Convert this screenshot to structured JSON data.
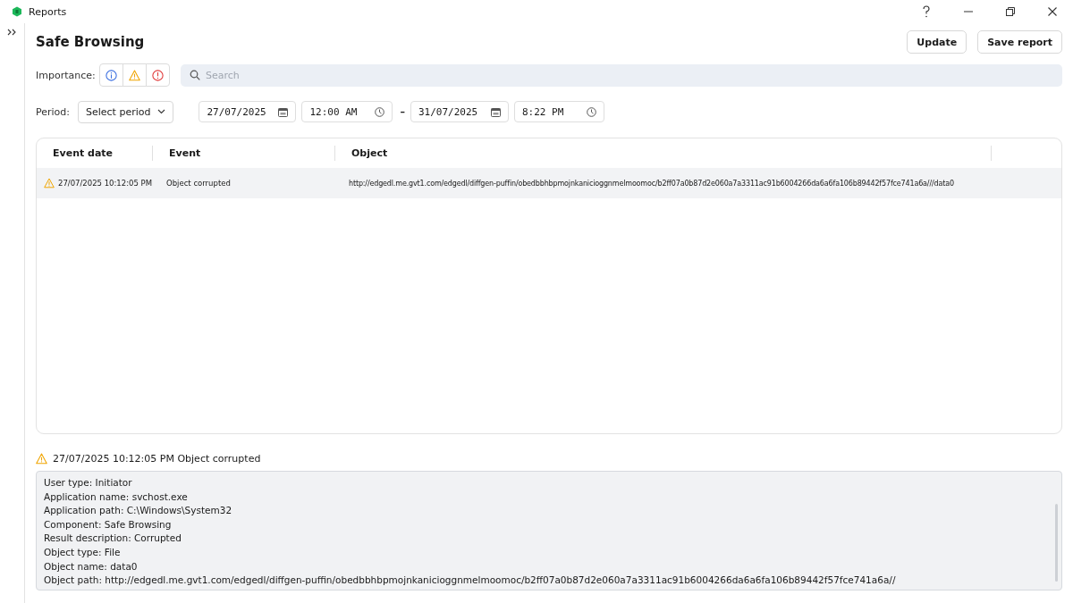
{
  "window": {
    "title": "Reports"
  },
  "page": {
    "title": "Safe Browsing",
    "buttons": [
      "Update",
      "Save report"
    ]
  },
  "importance": {
    "label": "Importance:",
    "levels": [
      {
        "kind": "info"
      },
      {
        "kind": "warning"
      },
      {
        "kind": "error"
      }
    ]
  },
  "search": {
    "placeholder": "Search"
  },
  "period": {
    "label": "Period:",
    "select": "Select period",
    "from_date": "27/07/2025",
    "from_time": "12:00 AM",
    "separator": "–",
    "to_date": "31/07/2025",
    "to_time": "8:22 PM"
  },
  "table": {
    "columns": [
      "Event date",
      "Event",
      "Object"
    ],
    "rows": [
      {
        "kind": "warning",
        "selected": true,
        "cells": [
          "27/07/2025 10:12:05 PM",
          "Object corrupted",
          "http://edgedl.me.gvt1.com/edgedl/diffgen-puffin/obedbbhbpmojnkanicioggnmelmoomoc/b2ff07a0b87d2e060a7a3311ac91b6004266da6a6fa106b89442f57fce741a6a///data0"
        ]
      }
    ]
  },
  "details": {
    "kind": "warning",
    "heading": "27/07/2025 10:12:05 PM Object corrupted",
    "lines": [
      "User type: Initiator",
      "Application name: svchost.exe",
      "Application path: C:\\Windows\\System32",
      "Component: Safe Browsing",
      "Result description: Corrupted",
      "Object type: File",
      "Object name: data0",
      "Object path: http://edgedl.me.gvt1.com/edgedl/diffgen-puffin/obedbbhbpmojnkanicioggnmelmoomoc/b2ff07a0b87d2e060a7a3311ac91b6004266da6a6fa106b89442f57fce741a6a//"
    ]
  }
}
